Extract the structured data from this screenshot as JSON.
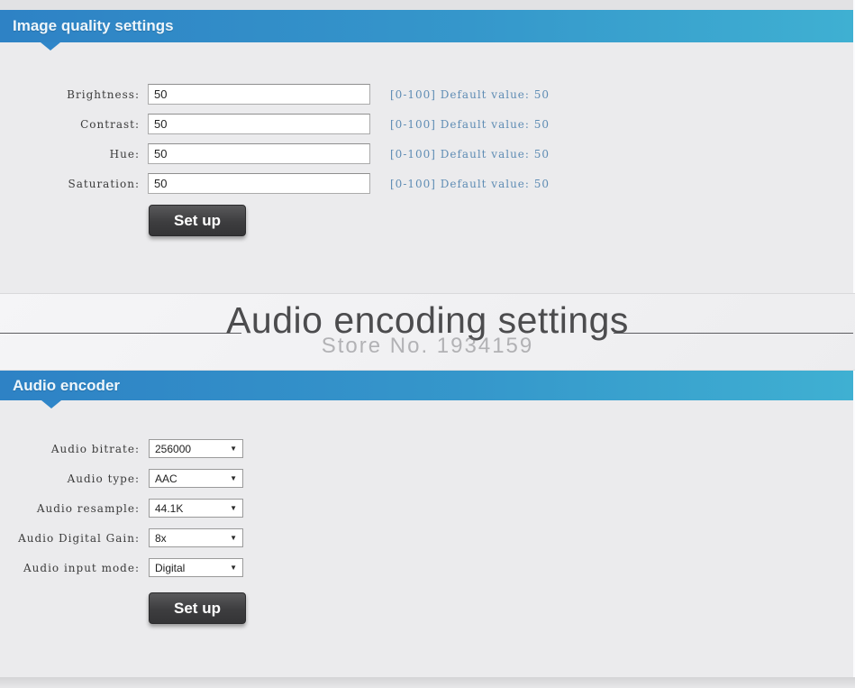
{
  "image_quality": {
    "header": "Image quality settings",
    "rows": [
      {
        "label": "Brightness:",
        "value": "50",
        "hint": "[0-100] Default value: 50"
      },
      {
        "label": "Contrast:",
        "value": "50",
        "hint": "[0-100] Default value: 50"
      },
      {
        "label": "Hue:",
        "value": "50",
        "hint": "[0-100] Default value: 50"
      },
      {
        "label": "Saturation:",
        "value": "50",
        "hint": "[0-100] Default value: 50"
      }
    ],
    "setup_button": "Set up"
  },
  "banner": {
    "title": "Audio encoding settings",
    "watermark": "Store No. 1934159"
  },
  "audio_encoder": {
    "header": "Audio encoder",
    "rows": [
      {
        "label": "Audio bitrate:",
        "value": "256000"
      },
      {
        "label": "Audio type:",
        "value": "AAC"
      },
      {
        "label": "Audio resample:",
        "value": "44.1K"
      },
      {
        "label": "Audio Digital Gain:",
        "value": "8x"
      },
      {
        "label": "Audio input mode:",
        "value": "Digital"
      }
    ],
    "setup_button": "Set up",
    "dropdown_arrow": "▼"
  },
  "colors": {
    "header_gradient_start": "#2e82c5",
    "header_gradient_end": "#3fb0d2",
    "hint_text": "#5e8cb4",
    "button_dark": "#3d3d3f",
    "page_background": "#ebebed"
  }
}
